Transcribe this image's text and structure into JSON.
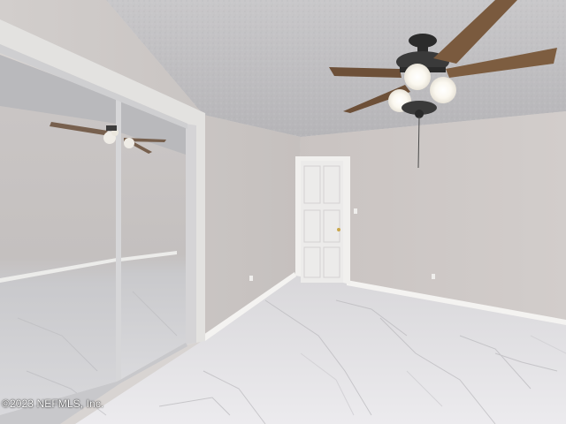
{
  "photo": {
    "watermark_text": "©2023 NEFMLS, Inc.",
    "subject": "empty bedroom with ceiling fan, mirrored closet doors and door"
  },
  "colors": {
    "wall": "#cfcac7",
    "ceiling": "#c4c3c4",
    "floor": "#e6e5e6",
    "trim": "#f4f3f1",
    "fan_blade": "#7a5a3e",
    "fan_metal": "#2a2a2a",
    "mirror_frame": "#d0d0d2"
  }
}
